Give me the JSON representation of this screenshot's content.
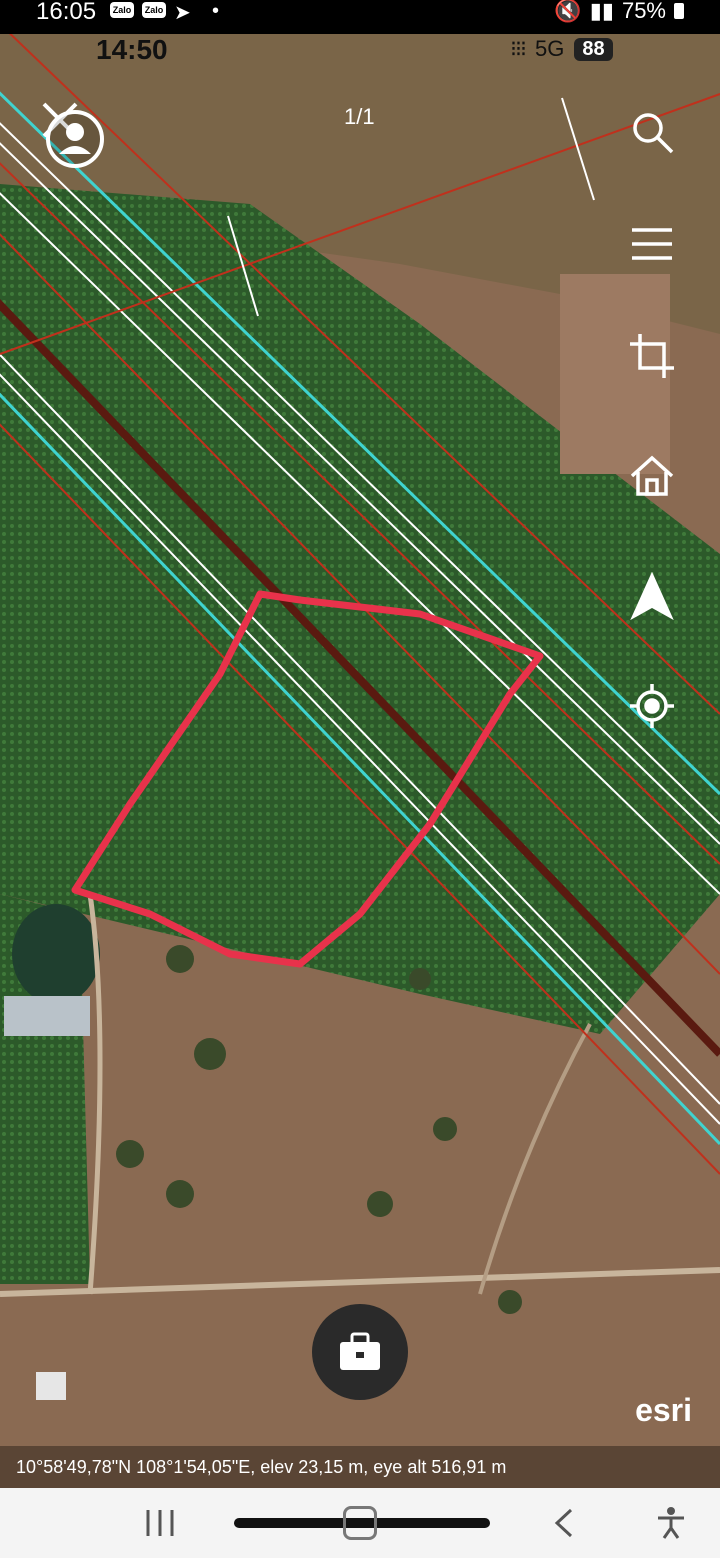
{
  "status_bar": {
    "time": "16:05",
    "app_badges": [
      "Zalo",
      "Zalo"
    ],
    "battery": "75%"
  },
  "app_overlay": {
    "inner_time": "14:50",
    "network": "5G",
    "network_badge": "88",
    "page_count": "1/1"
  },
  "toolbar": {
    "icons": [
      "search-icon",
      "list-icon",
      "crop-icon",
      "home-icon",
      "navigate-icon",
      "locate-icon"
    ]
  },
  "map": {
    "attribution": "esri",
    "coordinates": "10°58'49,78\"N 108°1'54,05\"E, elev 23,15 m, eye alt 516,91 m",
    "colors": {
      "parcel_outline": "#e8324b",
      "line_cyan": "#3fd3d0",
      "line_red": "#c0301c",
      "line_white": "#ffffff",
      "line_brown": "#5a1a10",
      "vegetation": "#2f5a2c",
      "dry_land": "#8a6a52"
    }
  },
  "nav_bar": {
    "icons": [
      "recent-apps-icon",
      "home-pill-icon",
      "back-icon",
      "accessibility-icon"
    ]
  }
}
